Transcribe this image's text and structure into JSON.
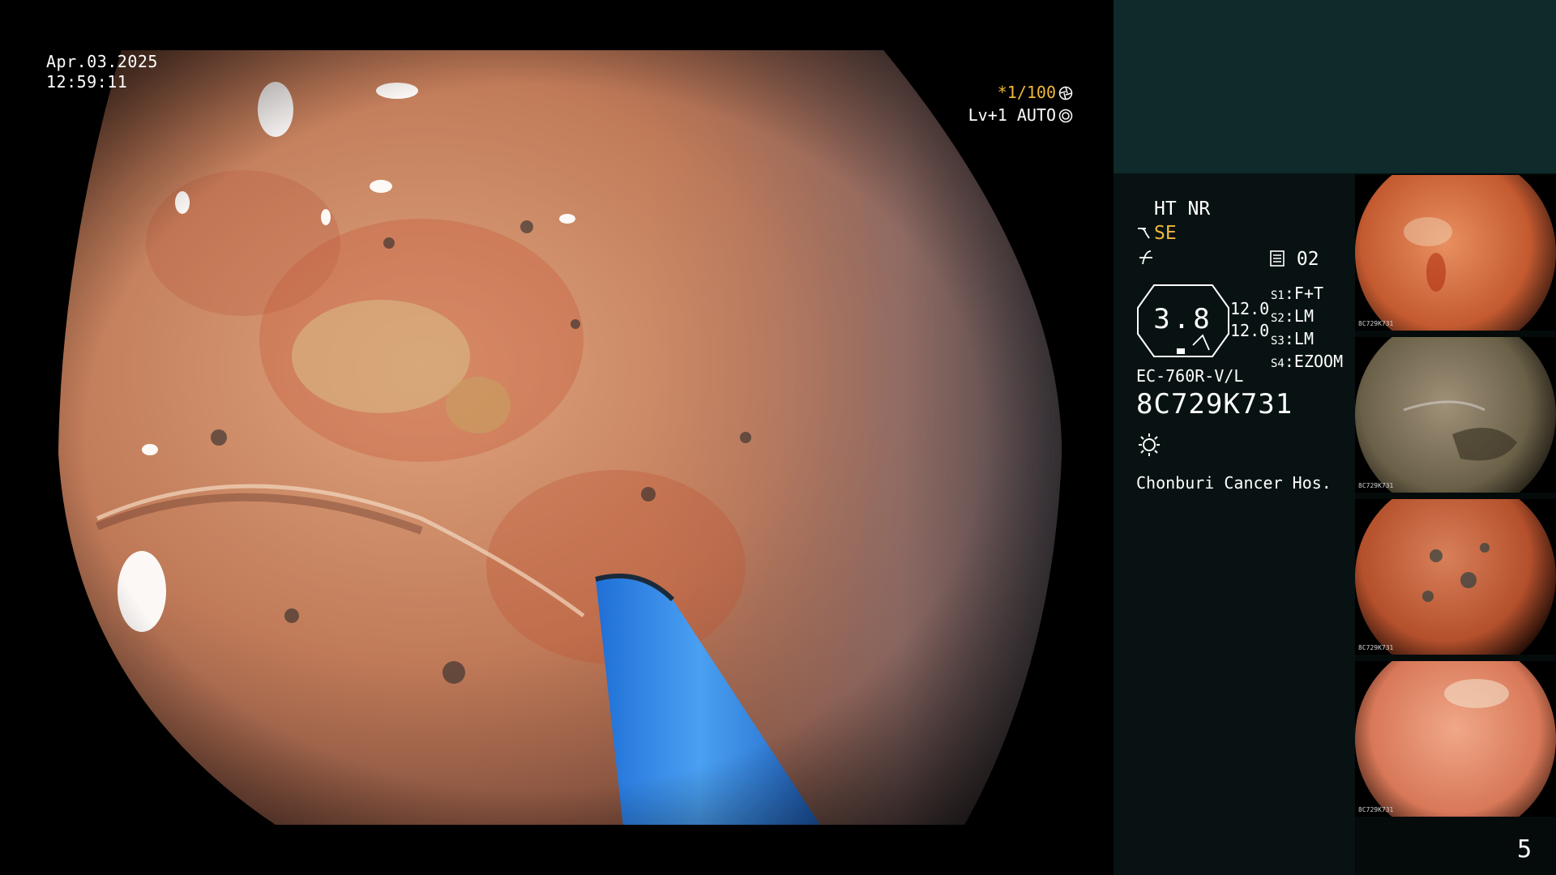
{
  "overlay": {
    "date": "Apr.03.2025",
    "time": "12:59:11",
    "shutter": "*1/100",
    "iris": "Lv+1 AUTO",
    "shutter_icon": "aperture-icon",
    "iris_icon": "iris-ring-icon"
  },
  "info": {
    "mode": "HT NR",
    "enhancement_label": "SE",
    "enhancement_icon": "probe-hook-icon",
    "curve_icon": "curve-icon",
    "counter_icon": "memory-card-icon",
    "counter": "02",
    "zoom_value": "3.8",
    "enhancement_levels": [
      "12.0",
      "12.0"
    ],
    "switches": [
      {
        "tag": "S1",
        "value": "F+T"
      },
      {
        "tag": "S2",
        "value": "LM"
      },
      {
        "tag": "S3",
        "value": "LM"
      },
      {
        "tag": "S4",
        "value": "EZOOM"
      }
    ],
    "scope_model": "EC-760R-V/L",
    "serial": "8C729K731",
    "light_icon": "sun-light-icon",
    "hospital": "Chonburi Cancer Hos."
  },
  "thumbnails": [
    {
      "label": "8C729K731"
    },
    {
      "label": "8C729K731"
    },
    {
      "label": "8C729K731"
    },
    {
      "label": "8C729K731"
    }
  ],
  "page_number": "5",
  "colors": {
    "accent_orange": "#f0b83a",
    "panel_teal": "#0e2a2a",
    "panel_dark": "#081212",
    "device_blue": "#2f86e6"
  }
}
